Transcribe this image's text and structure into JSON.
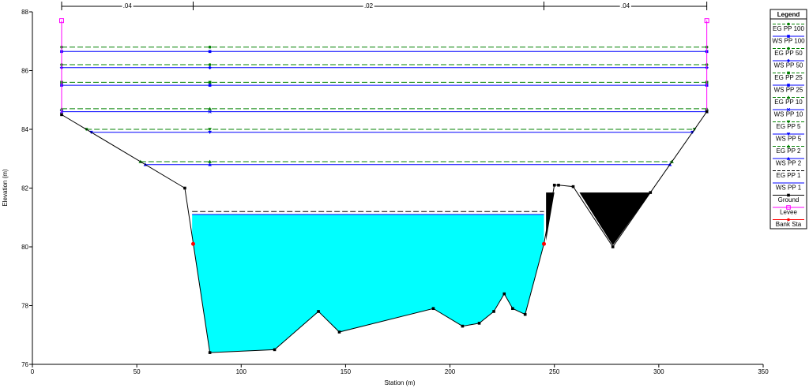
{
  "chart_data": {
    "type": "line",
    "xlabel": "Station (m)",
    "ylabel": "Elevation (m)",
    "xlim": [
      0,
      350
    ],
    "ylim": [
      76,
      88
    ],
    "x_ticks": [
      0,
      50,
      100,
      150,
      200,
      250,
      300,
      350
    ],
    "y_ticks": [
      76,
      78,
      80,
      82,
      84,
      86,
      88
    ],
    "grid": false,
    "legend_placement": "right",
    "legend_title": "Legend",
    "manning_n": [
      {
        "label": ".04",
        "from": 14,
        "to": 77
      },
      {
        "label": ".02",
        "from": 77,
        "to": 245
      },
      {
        "label": ".04",
        "from": 245,
        "to": 323
      }
    ],
    "ground": {
      "name": "Ground",
      "x": [
        14,
        73,
        85,
        116,
        137,
        147,
        192,
        206,
        214,
        221,
        226,
        230,
        236,
        245,
        250,
        252,
        259,
        278,
        296,
        323
      ],
      "y": [
        84.5,
        82.0,
        76.4,
        76.5,
        77.8,
        77.1,
        77.9,
        77.3,
        77.4,
        77.8,
        78.4,
        77.9,
        77.7,
        80.1,
        82.1,
        82.1,
        82.05,
        80.0,
        81.85,
        84.6
      ]
    },
    "levee": {
      "name": "Levee",
      "left": {
        "x": 14,
        "y": 87.7
      },
      "right": {
        "x": 323,
        "y": 87.7
      }
    },
    "bank_stations": {
      "name": "Bank Sta",
      "x": [
        77,
        245
      ],
      "y": [
        80.1,
        80.1
      ]
    },
    "ineffective_blocks": [
      {
        "x": [
          246,
          246,
          250,
          246
        ],
        "y": [
          81.85,
          80.2,
          81.85,
          81.85
        ]
      },
      {
        "x": [
          262,
          296,
          278,
          262
        ],
        "y": [
          81.85,
          81.85,
          80.05,
          81.85
        ]
      }
    ],
    "water_fill": {
      "x_left": 76.5,
      "x_right": 245,
      "ws": 81.1,
      "color": "#00ffff"
    },
    "series": [
      {
        "name": "EG PP 100",
        "kind": "EG",
        "value": 86.8,
        "marker": "circle",
        "color": "#008000"
      },
      {
        "name": "WS PP 100",
        "kind": "WS",
        "value": 86.65,
        "marker": "square",
        "color": "#0000ff"
      },
      {
        "name": "EG PP 50",
        "kind": "EG",
        "value": 86.2,
        "marker": "circle",
        "color": "#008000"
      },
      {
        "name": "WS PP 50",
        "kind": "WS",
        "value": 86.1,
        "marker": "diamond",
        "color": "#0000ff"
      },
      {
        "name": "EG PP 25",
        "kind": "EG",
        "value": 85.6,
        "marker": "square",
        "color": "#008000"
      },
      {
        "name": "WS PP 25",
        "kind": "WS",
        "value": 85.5,
        "marker": "square",
        "color": "#0000ff"
      },
      {
        "name": "EG PP 10",
        "kind": "EG",
        "value": 84.7,
        "marker": "triangle",
        "color": "#008000"
      },
      {
        "name": "WS PP 10",
        "kind": "WS",
        "value": 84.6,
        "marker": "cross",
        "color": "#0000ff"
      },
      {
        "name": "EG PP 5",
        "kind": "EG",
        "value": 84.0,
        "marker": "triangle-down",
        "color": "#008000"
      },
      {
        "name": "WS PP 5",
        "kind": "WS",
        "value": 83.9,
        "marker": "triangle-down",
        "color": "#0000ff"
      },
      {
        "name": "EG PP 2",
        "kind": "EG",
        "value": 82.9,
        "marker": "triangle",
        "color": "#008000"
      },
      {
        "name": "WS PP 2",
        "kind": "WS",
        "value": 82.8,
        "marker": "triangle",
        "color": "#0000ff"
      },
      {
        "name": "EG PP 1",
        "kind": "EG",
        "value": 81.2,
        "marker": "none",
        "color": "#000000"
      },
      {
        "name": "WS PP 1",
        "kind": "WS",
        "value": 81.1,
        "marker": "none",
        "color": "#0000ff"
      }
    ],
    "legend_extra": [
      {
        "name": "Ground",
        "color": "#000000",
        "marker": "square"
      },
      {
        "name": "Levee",
        "color": "#ff00ff",
        "marker": "open-square"
      },
      {
        "name": "Bank Sta",
        "color": "#ff0000",
        "marker": "circle"
      }
    ]
  }
}
